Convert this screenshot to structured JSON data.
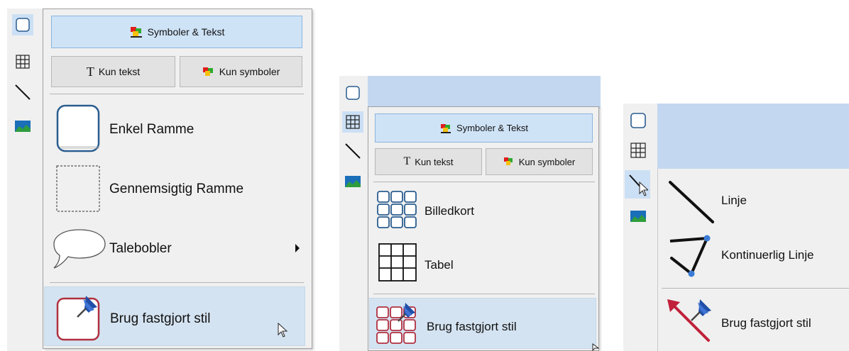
{
  "panels": [
    {
      "top_button": "Symboler & Tekst",
      "btn_text_only": "Kun tekst",
      "btn_symbols_only": "Kun symboler",
      "items": [
        "Enkel Ramme",
        "Gennemsigtig Ramme",
        "Talebobler",
        "Brug fastgjort stil"
      ]
    },
    {
      "top_button": "Symboler & Tekst",
      "btn_text_only": "Kun tekst",
      "btn_symbols_only": "Kun symboler",
      "items": [
        "Billedkort",
        "Tabel",
        "Brug fastgjort stil"
      ]
    },
    {
      "items": [
        "Linje",
        "Kontinuerlig Linje",
        "Brug fastgjort stil"
      ]
    }
  ],
  "sidebar_icons": [
    "frame-icon",
    "table-icon",
    "line-icon",
    "picture-icon"
  ],
  "colors": {
    "accent_bg": "#cfe3f7",
    "header_bar": "#c3d7f0",
    "highlight": "#d4e3f1",
    "pin_blue": "#1f4fa8",
    "frame_red": "#b03040"
  }
}
